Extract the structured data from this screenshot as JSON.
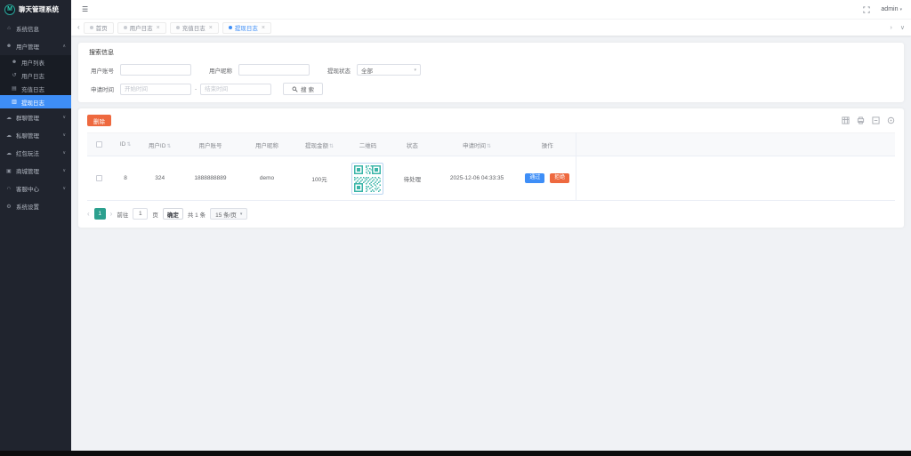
{
  "app": {
    "title": "聊天管理系统"
  },
  "topbar": {
    "username": "admin"
  },
  "icons": {
    "logo": "M",
    "hamburger": "☰",
    "home": "⌂",
    "user": "☻",
    "user_list": "☻",
    "user_log": "↺",
    "recharge_log": "▤",
    "withdraw_log": "▥",
    "group_chat": "☁",
    "private_chat": "☁",
    "red_packet": "☁",
    "mall": "▣",
    "service": "∩",
    "settings": "⚙",
    "chevron_up": "∧",
    "chevron_down": "∨",
    "caret_down": "▾",
    "sort": "⇅",
    "close": "×",
    "tab_prev": "‹",
    "tab_next": "›",
    "dot": "●"
  },
  "sidebar": {
    "items": [
      {
        "label": "系统信息"
      },
      {
        "label": "用户管理"
      },
      {
        "label": "用户列表"
      },
      {
        "label": "用户日志"
      },
      {
        "label": "充值日志"
      },
      {
        "label": "提现日志"
      },
      {
        "label": "群聊管理"
      },
      {
        "label": "私聊管理"
      },
      {
        "label": "红包玩法"
      },
      {
        "label": "商城管理"
      },
      {
        "label": "客服中心"
      },
      {
        "label": "系统设置"
      }
    ]
  },
  "tabs": {
    "items": [
      {
        "label": "首页"
      },
      {
        "label": "用户日志"
      },
      {
        "label": "充值日志"
      },
      {
        "label": "提现日志"
      }
    ]
  },
  "search": {
    "title": "搜索信息",
    "account_label": "用户账号",
    "nickname_label": "用户昵称",
    "status_label": "提现状态",
    "status_value": "全部",
    "time_label": "申请时间",
    "start_placeholder": "开始时间",
    "end_placeholder": "结束时间",
    "range_separator": "-",
    "search_button": "搜 索"
  },
  "table": {
    "delete_button": "删除",
    "columns": [
      "ID",
      "用户ID",
      "用户账号",
      "用户昵称",
      "提现金额",
      "二维码",
      "状态",
      "申请时间",
      "操作"
    ],
    "rows": [
      {
        "id": "8",
        "user_id": "324",
        "account": "1888888889",
        "nickname": "demo",
        "amount": "100元",
        "status": "待处理",
        "apply_time": "2025-12-06 04:33:35",
        "approve_label": "通过",
        "reject_label": "拒绝"
      }
    ]
  },
  "pagination": {
    "page": "1",
    "goto_label": "前往",
    "goto_value": "1",
    "page_unit": "页",
    "confirm_label": "确定",
    "total_label": "共 1 条",
    "page_size": "15 条/页"
  },
  "colors": {
    "accent_blue": "#3e8ef7",
    "amount_teal": "#17b3a3",
    "status_orange": "#e6a23c",
    "danger_orange": "#ee693f",
    "pager_teal": "#2ca08e",
    "sidebar_bg": "#20242e"
  }
}
